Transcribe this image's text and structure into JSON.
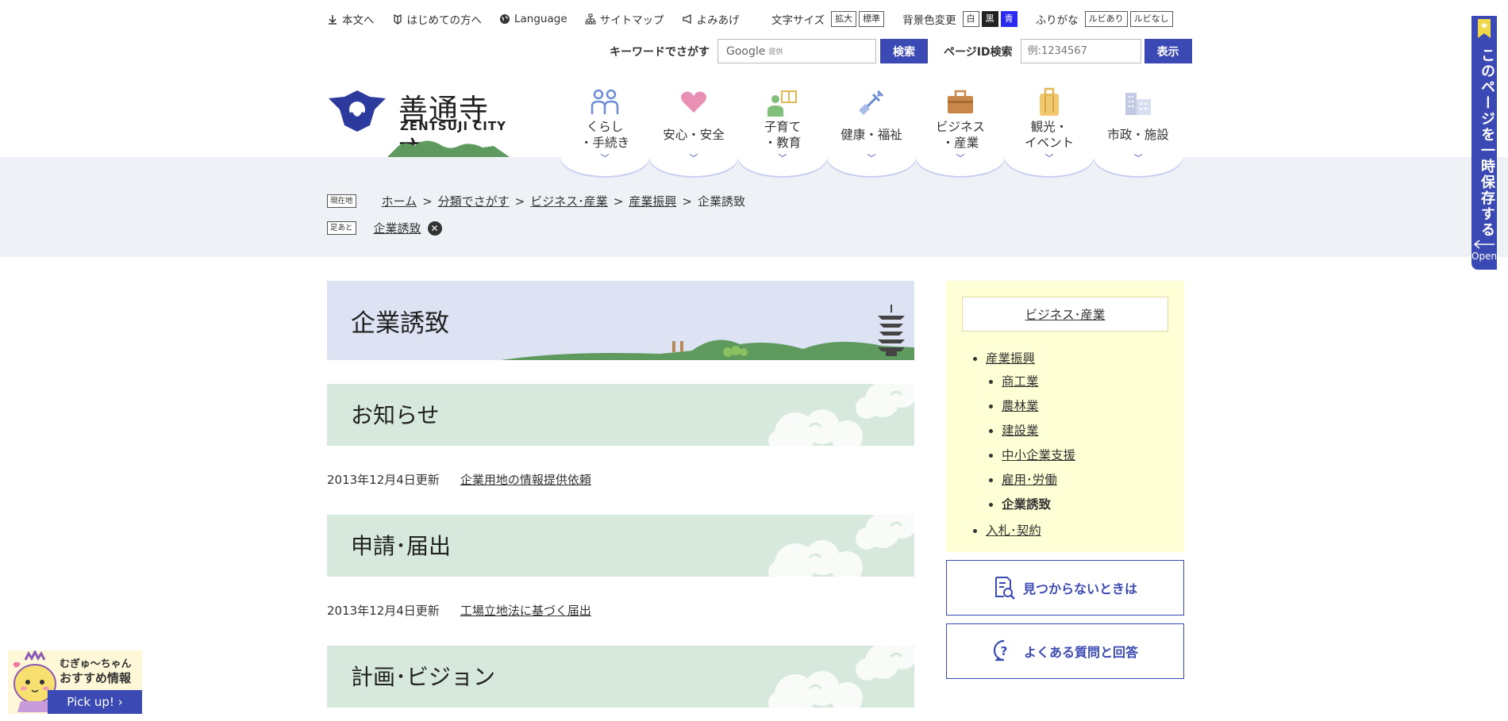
{
  "util": {
    "honbun": "本文へ",
    "hajimete": "はじめての方へ",
    "language": "Language",
    "sitemap": "サイトマップ",
    "yomiage": "よみあげ"
  },
  "controls": {
    "font_size_label": "文字サイズ",
    "font_large": "拡大",
    "font_standard": "標準",
    "bg_label": "背景色変更",
    "bg_white": "白",
    "bg_black": "黒",
    "bg_blue": "青",
    "furigana_label": "ふりがな",
    "ruby_on": "ルビあり",
    "ruby_off": "ルビなし"
  },
  "search": {
    "keyword_label": "キーワードでさがす",
    "google": "Google",
    "google_sub": "提供",
    "search_button": "検索",
    "pageid_label": "ページID検索",
    "pageid_placeholder": "例:1234567",
    "show_button": "表示"
  },
  "logo": {
    "jp": "善通寺市",
    "en": "ZENTSUJI CITY"
  },
  "nav": [
    {
      "line1": "くらし",
      "line2": "・手続き",
      "color": "#6c8dd6"
    },
    {
      "line1": "安心・安全",
      "line2": "",
      "color": "#e07aa6"
    },
    {
      "line1": "子育て",
      "line2": "・教育",
      "color": "#7fbf7a"
    },
    {
      "line1": "健康・福祉",
      "line2": "",
      "color": "#6c8dd6"
    },
    {
      "line1": "ビジネス",
      "line2": "・産業",
      "color": "#c9874a"
    },
    {
      "line1": "観光・",
      "line2": "イベント",
      "color": "#e0b85a"
    },
    {
      "line1": "市政・施設",
      "line2": "",
      "color": "#9aa7c9"
    }
  ],
  "breadcrumb": {
    "current_tag": "現在地",
    "items": [
      "ホーム",
      "分類でさがす",
      "ビジネス･産業",
      "産業振興"
    ],
    "current": "企業誘致",
    "history_tag": "足あと",
    "history_item": "企業誘致"
  },
  "main": {
    "title": "企業誘致",
    "sections": [
      {
        "heading": "お知らせ",
        "date": "2013年12月4日更新",
        "link": "企業用地の情報提供依頼"
      },
      {
        "heading": "申請･届出",
        "date": "2013年12月4日更新",
        "link": "工場立地法に基づく届出"
      },
      {
        "heading": "計画･ビジョン"
      }
    ]
  },
  "sidebar": {
    "heading": "ビジネス･産業",
    "level1a": "産業振興",
    "sub": [
      "商工業",
      "農林業",
      "建設業",
      "中小企業支援",
      "雇用･労働"
    ],
    "current": "企業誘致",
    "level1b": "入札･契約"
  },
  "boxes": {
    "notfound": "見つからないときは",
    "faq": "よくある質問と回答"
  },
  "right_tab": {
    "text": "このページを一時保存する",
    "open": "Open"
  },
  "mascot": {
    "line1": "むぎゅ～ちゃん",
    "line2": "おすすめ情報",
    "pickup": "Pick up!"
  },
  "colors": {
    "accent": "#3b49b4",
    "band": "#eef2f7",
    "section": "#d7e8dd",
    "sidebar": "#ffffd5"
  }
}
